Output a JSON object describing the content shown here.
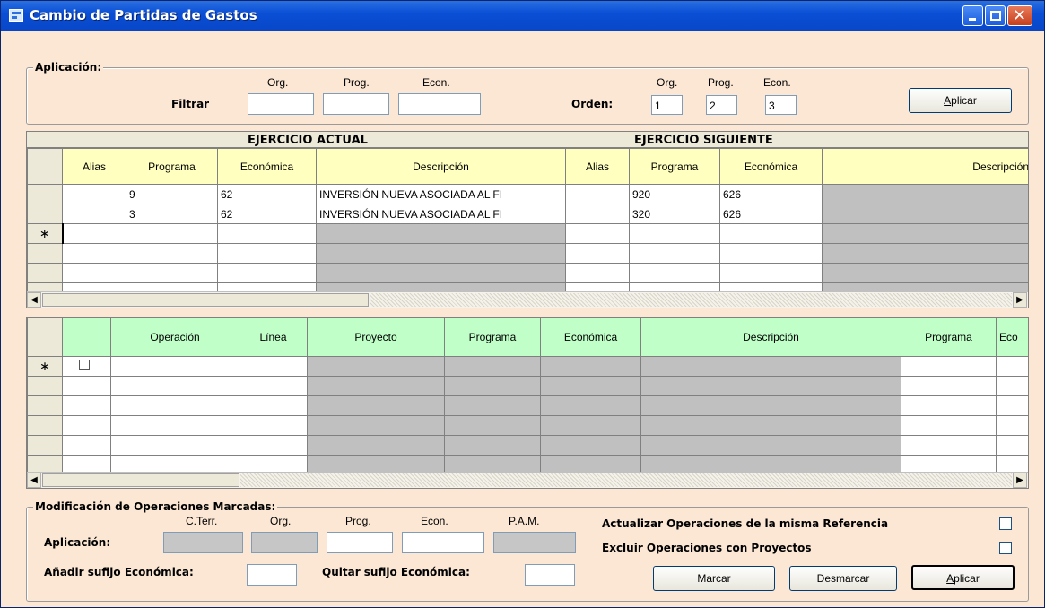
{
  "window": {
    "title": "Cambio de Partidas de Gastos"
  },
  "aplicacion": {
    "legend": "Aplicación:",
    "filtrar_label": "Filtrar",
    "filter_headers": {
      "org": "Org.",
      "prog": "Prog.",
      "econ": "Econ."
    },
    "filter_values": {
      "org": "",
      "prog": "",
      "econ": ""
    },
    "orden_label": "Orden:",
    "orden_headers": {
      "org": "Org.",
      "prog": "Prog.",
      "econ": "Econ."
    },
    "orden_values": {
      "org": "1",
      "prog": "2",
      "econ": "3"
    },
    "aplicar_button": {
      "prefix": "",
      "mnemonic": "A",
      "rest": "plicar"
    }
  },
  "grid_top": {
    "band_actual": "EJERCICIO ACTUAL",
    "band_siguiente": "EJERCICIO SIGUIENTE",
    "columns": [
      "Alias",
      "Programa",
      "Económica",
      "Descripción",
      "Alias",
      "Programa",
      "Económica",
      "Descripción"
    ],
    "rows": [
      [
        "",
        "9",
        "62",
        "INVERSIÓN NUEVA ASOCIADA AL FI",
        "",
        "920",
        "626",
        ""
      ],
      [
        "",
        "3",
        "62",
        "INVERSIÓN NUEVA ASOCIADA AL FI",
        "",
        "320",
        "626",
        ""
      ]
    ],
    "new_row_marker": "∗"
  },
  "grid_bottom": {
    "columns": [
      "",
      "Operación",
      "Línea",
      "Proyecto",
      "Programa",
      "Económica",
      "Descripción",
      "Programa",
      "Eco"
    ],
    "new_row_marker": "∗"
  },
  "modificacion": {
    "legend": "Modificación de Operaciones Marcadas:",
    "aplicacion_label": "Aplicación:",
    "headers": {
      "cterr": "C.Terr.",
      "org": "Org.",
      "prog": "Prog.",
      "econ": "Econ.",
      "pam": "P.A.M."
    },
    "values": {
      "cterr": "",
      "org": "",
      "prog": "",
      "econ": "",
      "pam": ""
    },
    "anadir_sufijo_label": "Añadir sufijo Económica:",
    "quitar_sufijo_label": "Quitar sufijo Económica:",
    "actualizar_label": "Actualizar Operaciones de la misma Referencia",
    "excluir_label": "Excluir Operaciones con Proyectos",
    "marcar_button": "Marcar",
    "desmarcar_button": "Desmarcar",
    "aplicar_button": {
      "mnemonic": "A",
      "rest": "plicar"
    }
  },
  "colors": {
    "window_bg": "#fbe7d4",
    "titlebar": "#0a4fd6",
    "header_yellow": "#ffffc0",
    "header_green": "#c0ffc8",
    "disabled_gray": "#c0c0c0"
  }
}
